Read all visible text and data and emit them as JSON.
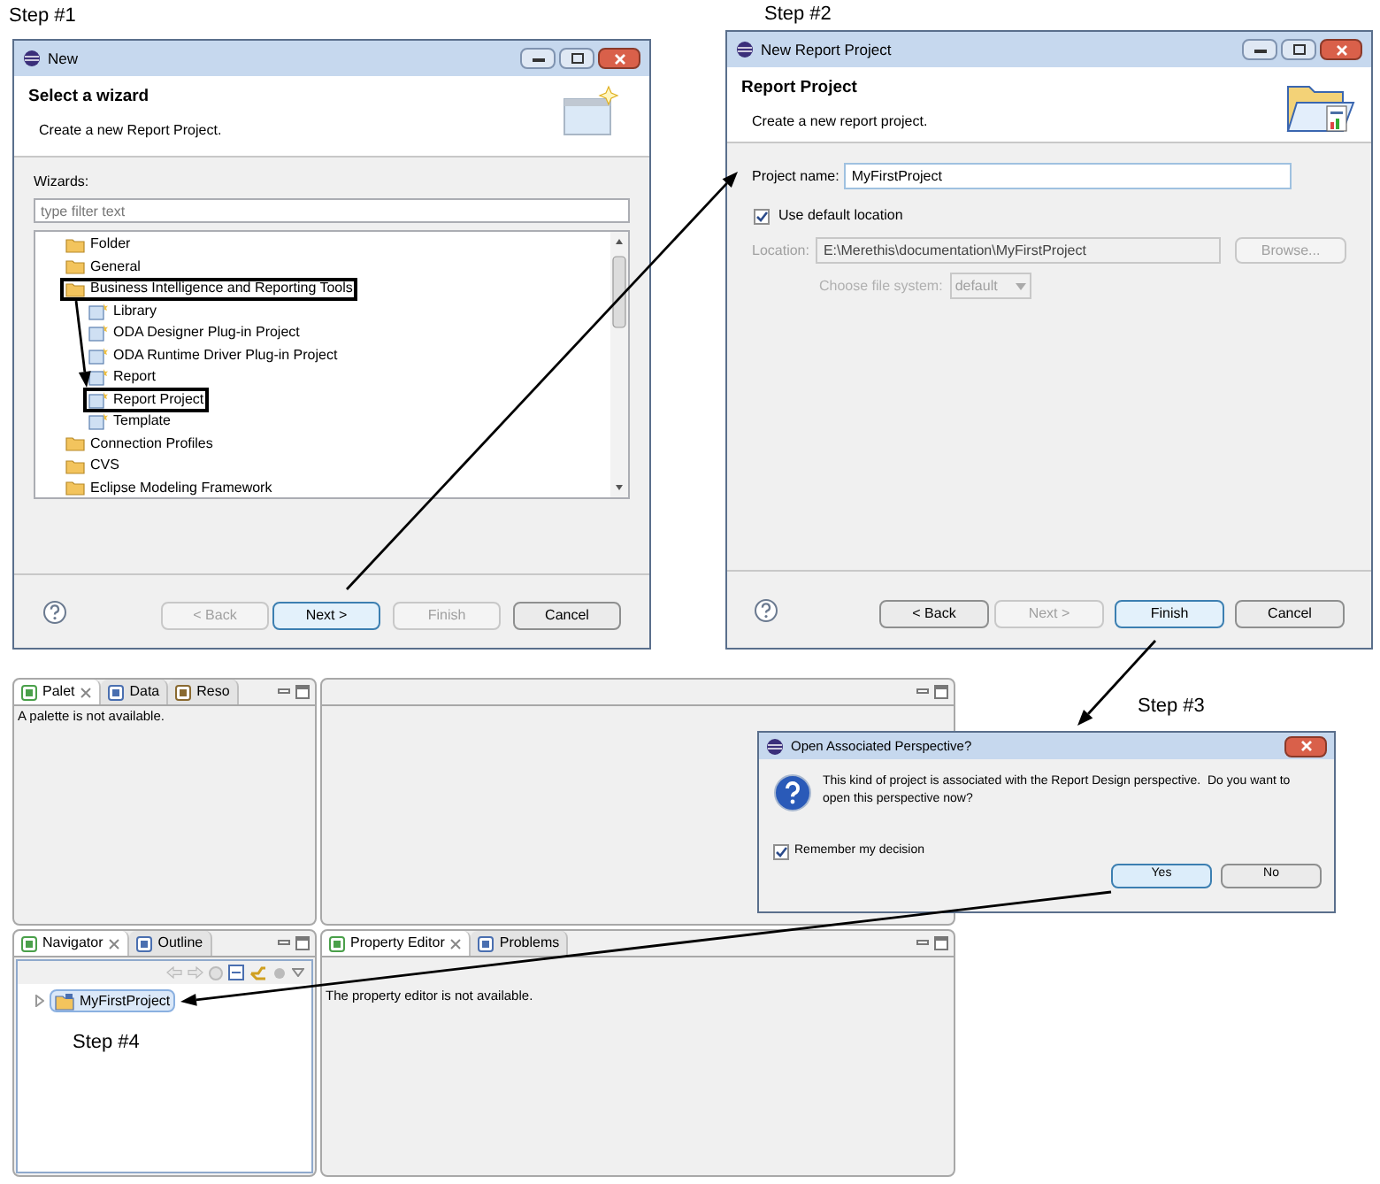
{
  "step_labels": [
    "Step #1",
    "Step #2",
    "Step #3",
    "Step #4"
  ],
  "new_wizard": {
    "title": "New",
    "heading": "Select a wizard",
    "description": "Create a new Report Project.",
    "filter_label": "Wizards:",
    "filter": {
      "placeholder": "type filter text"
    },
    "tree": [
      {
        "label": "Folder",
        "kind": "folder",
        "highlighted": false
      },
      {
        "label": "General",
        "kind": "folder",
        "highlighted": false
      },
      {
        "label": "Business Intelligence and Reporting Tools",
        "kind": "folder",
        "highlighted": true,
        "children": [
          {
            "label": "Library",
            "kind": "item",
            "highlighted": false
          },
          {
            "label": "ODA Designer Plug-in Project",
            "kind": "item",
            "highlighted": false
          },
          {
            "label": "ODA Runtime Driver Plug-in Project",
            "kind": "item",
            "highlighted": false
          },
          {
            "label": "Report",
            "kind": "item",
            "highlighted": false
          },
          {
            "label": "Report Project",
            "kind": "item",
            "highlighted": true
          },
          {
            "label": "Template",
            "kind": "item",
            "highlighted": false
          }
        ]
      },
      {
        "label": "Connection Profiles",
        "kind": "folder",
        "highlighted": false
      },
      {
        "label": "CVS",
        "kind": "folder",
        "highlighted": false
      },
      {
        "label": "Eclipse Modeling Framework",
        "kind": "folder",
        "highlighted": false
      }
    ],
    "buttons": [
      {
        "label": "< Back",
        "disabled": true,
        "default": false
      },
      {
        "label": "Next >",
        "disabled": false,
        "default": true
      },
      {
        "label": "Finish",
        "disabled": true,
        "default": false
      },
      {
        "label": "Cancel",
        "disabled": false,
        "default": false
      }
    ]
  },
  "report_project_wizard": {
    "title": "New Report Project",
    "heading": "Report Project",
    "description": "Create a new report project.",
    "project_name": {
      "label": "Project name:",
      "value": "MyFirstProject"
    },
    "use_default_location": {
      "label": "Use default location",
      "checked": true
    },
    "location": {
      "label": "Location:",
      "value": "E:\\Merethis\\documentation\\MyFirstProject",
      "disabled": true
    },
    "browse_button": {
      "label": "Browse...",
      "disabled": true
    },
    "file_system": {
      "label": "Choose file system:",
      "value": "default",
      "disabled": true
    },
    "buttons": [
      {
        "label": "< Back",
        "disabled": false,
        "default": false
      },
      {
        "label": "Next >",
        "disabled": true,
        "default": false
      },
      {
        "label": "Finish",
        "disabled": false,
        "default": true
      },
      {
        "label": "Cancel",
        "disabled": false,
        "default": false
      }
    ]
  },
  "workbench": {
    "palette_view": {
      "tabs": [
        {
          "label": "Palet",
          "selected": true
        },
        {
          "label": "Data",
          "selected": false
        },
        {
          "label": "Reso",
          "selected": false
        }
      ],
      "message": "A palette is not available."
    },
    "navigator_view": {
      "tabs": [
        {
          "label": "Navigator",
          "selected": true
        },
        {
          "label": "Outline",
          "selected": false
        }
      ],
      "tree": [
        {
          "label": "MyFirstProject",
          "selected": true
        }
      ]
    },
    "property_view": {
      "tabs": [
        {
          "label": "Property Editor",
          "selected": true
        },
        {
          "label": "Problems",
          "selected": false
        }
      ],
      "message": "The property editor is not available."
    }
  },
  "perspective_dialog": {
    "title": "Open Associated Perspective?",
    "message": "This kind of project is associated with the Report Design perspective.  Do you want to open this perspective now?",
    "remember": {
      "label": "Remember my decision",
      "checked": true
    },
    "buttons": [
      {
        "label": "Yes",
        "default": true
      },
      {
        "label": "No",
        "default": false
      }
    ]
  }
}
